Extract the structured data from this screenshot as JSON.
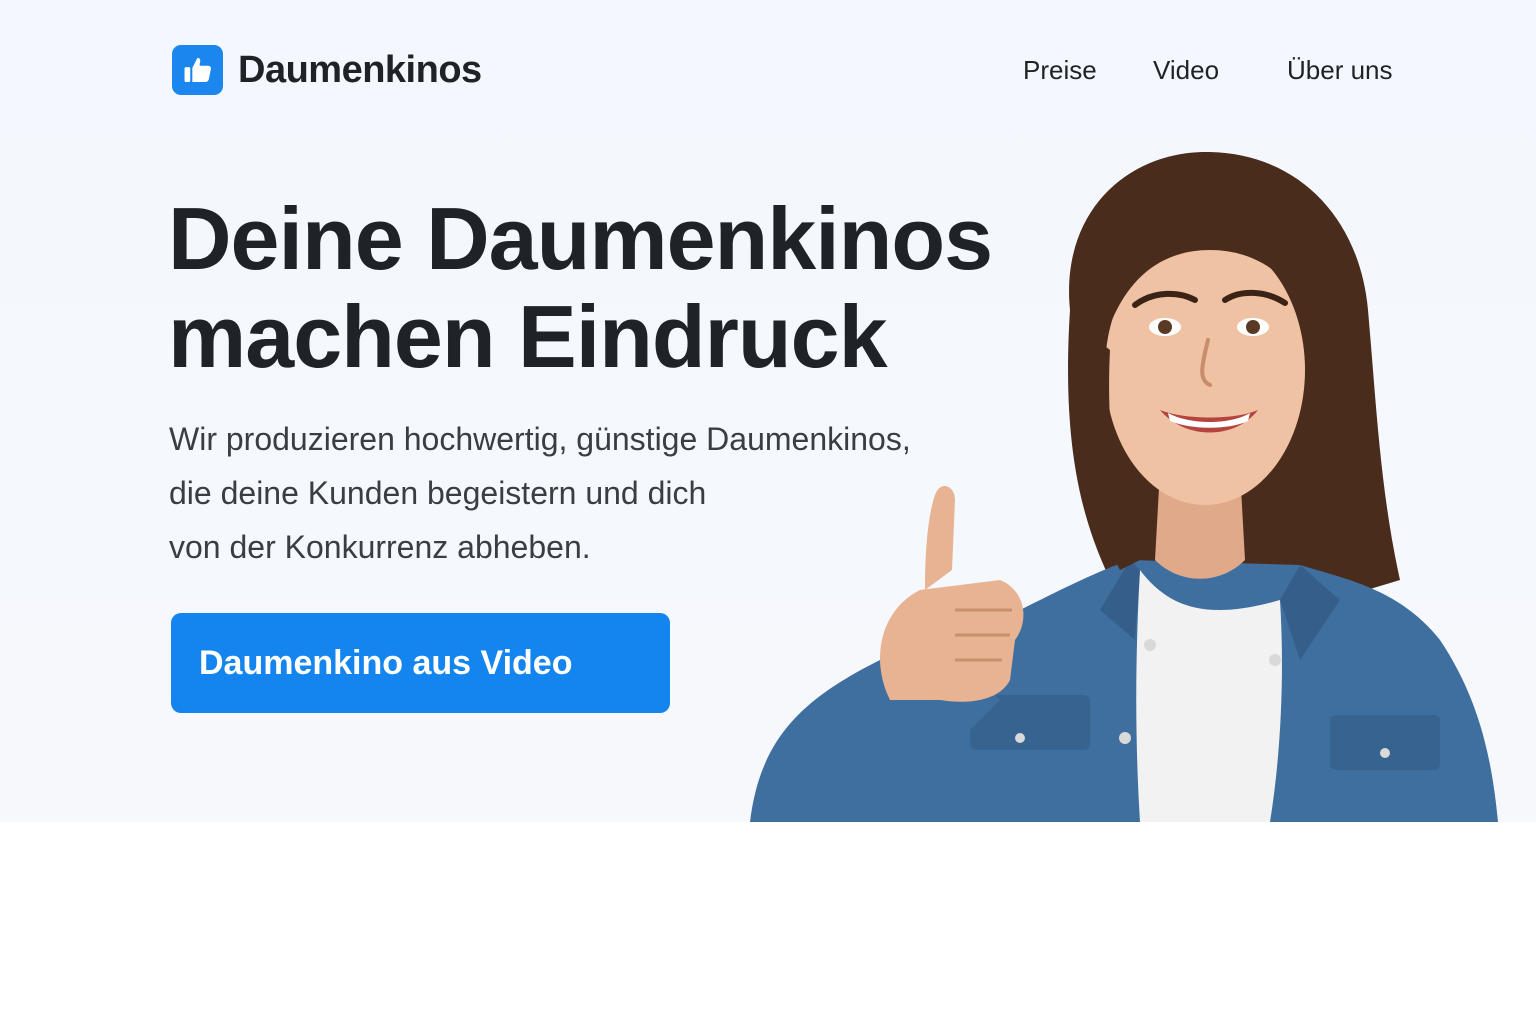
{
  "header": {
    "brand_name": "Daumenkinos",
    "logo_icon": "thumbs-up-icon",
    "nav": [
      {
        "label": "Preise"
      },
      {
        "label": "Video"
      },
      {
        "label": "Über uns"
      }
    ]
  },
  "hero": {
    "headline_lines": [
      "Deine Daumenkinos",
      "machen Eindruck"
    ],
    "subtext_lines": [
      "Wir produzieren hochwertig, günstige Daumenkinos,",
      "die deine Kunden begeistern und dich",
      "von der Konkurrenz abheben."
    ],
    "cta_label": "Daumenkino aus Video",
    "image": "woman-thumbs-up-photo"
  },
  "colors": {
    "accent": "#1485ee",
    "text_dark": "#1f2226",
    "text_body": "#3a3e44",
    "hero_bg": "#f4f7fd",
    "denim": "#3f6f9e"
  }
}
